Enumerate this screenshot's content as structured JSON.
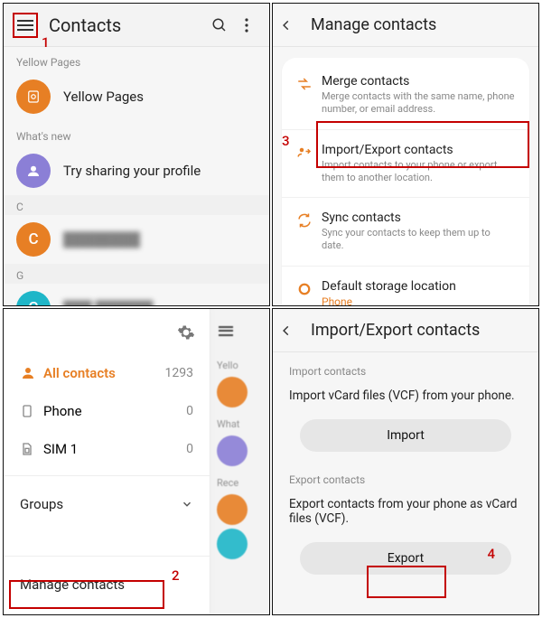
{
  "annotations": {
    "a1": "1",
    "a2": "2",
    "a3": "3",
    "a4": "4"
  },
  "p1": {
    "title": "Contacts",
    "sections": {
      "yellow": "Yellow Pages",
      "yellow_item": "Yellow Pages",
      "whatsnew": "What's new",
      "whatsnew_item": "Try sharing your profile",
      "letter_c": "C",
      "letter_g": "G"
    }
  },
  "p2": {
    "title": "Manage contacts",
    "items": [
      {
        "title": "Merge contacts",
        "sub": "Merge contacts with the same name, phone number, or email address."
      },
      {
        "title": "Import/Export contacts",
        "sub": "Import contacts to your phone or export them to another location."
      },
      {
        "title": "Sync contacts",
        "sub": "Sync your contacts to keep them up to date."
      },
      {
        "title": "Default storage location",
        "sub": "Phone"
      }
    ]
  },
  "p3": {
    "all": "All contacts",
    "all_count": "1293",
    "phone": "Phone",
    "phone_count": "0",
    "sim": "SIM 1",
    "sim_count": "0",
    "groups": "Groups",
    "manage": "Manage contacts"
  },
  "p4": {
    "title": "Import/Export contacts",
    "import_header": "Import contacts",
    "import_desc": "Import vCard files (VCF) from your phone.",
    "import_btn": "Import",
    "export_header": "Export contacts",
    "export_desc": "Export contacts from your phone as vCard files (VCF).",
    "export_btn": "Export"
  }
}
